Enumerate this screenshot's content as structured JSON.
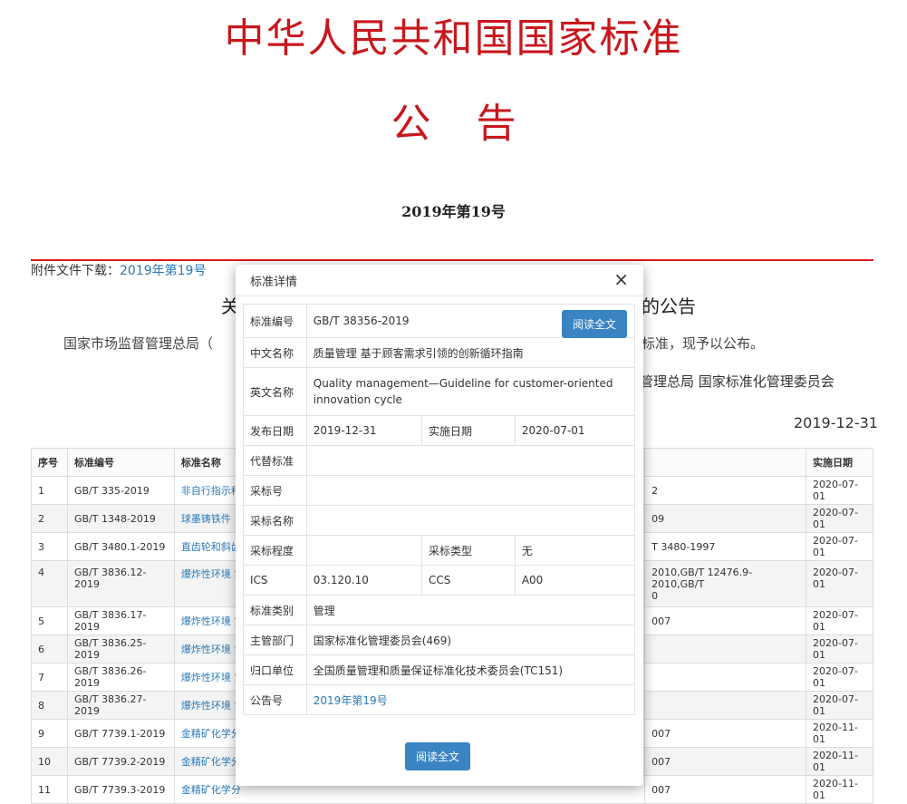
{
  "header": {
    "title": "中华人民共和国国家标准",
    "subtitle": "公告",
    "issue": "2019年第19号"
  },
  "attachment": {
    "label": "附件文件下载：",
    "link": "2019年第19号"
  },
  "background": {
    "heading_left": "关",
    "heading_right": "的公告",
    "para_left": "国家市场监督管理总局（",
    "para_right": "标准，现予以公布。",
    "signer": "管理总局 国家标准化管理委员会",
    "date": "2019-12-31"
  },
  "table": {
    "headers": [
      "序号",
      "标准编号",
      "标准名称",
      "实施日期"
    ],
    "rows": [
      {
        "no": "1",
        "code": "GB/T 335-2019",
        "name": "非自行指示秤",
        "replace": "2",
        "date": "2020-07-01"
      },
      {
        "no": "2",
        "code": "GB/T 1348-2019",
        "name": "球墨铸铁件",
        "replace": "09",
        "date": "2020-07-01"
      },
      {
        "no": "3",
        "code": "GB/T 3480.1-2019",
        "name": "直齿轮和斜齿",
        "replace": "T 3480-1997",
        "date": "2020-07-01"
      },
      {
        "no": "4",
        "code": "GB/T 3836.12-2019",
        "name": "爆炸性环境 第",
        "replace": "2010,GB/T 12476.9-2010,GB/T",
        "replace2": "0",
        "date": "2020-07-01"
      },
      {
        "no": "5",
        "code": "GB/T 3836.17-2019",
        "name": "爆炸性环境 第",
        "replace": "007",
        "date": "2020-07-01"
      },
      {
        "no": "6",
        "code": "GB/T 3836.25-2019",
        "name": "爆炸性环境 第",
        "replace": "",
        "date": "2020-07-01"
      },
      {
        "no": "7",
        "code": "GB/T 3836.26-2019",
        "name": "爆炸性环境 第",
        "replace": "",
        "date": "2020-07-01"
      },
      {
        "no": "8",
        "code": "GB/T 3836.27-2019",
        "name": "爆炸性环境 第",
        "replace": "",
        "date": "2020-07-01"
      },
      {
        "no": "9",
        "code": "GB/T 7739.1-2019",
        "name": "金精矿化学分",
        "replace": "007",
        "date": "2020-11-01"
      },
      {
        "no": "10",
        "code": "GB/T 7739.2-2019",
        "name": "金精矿化学分",
        "replace": "007",
        "date": "2020-11-01"
      },
      {
        "no": "11",
        "code": "GB/T 7739.3-2019",
        "name": "金精矿化学分",
        "replace": "007",
        "date": "2020-11-01"
      }
    ]
  },
  "modal": {
    "title": "标准详情",
    "close": "×",
    "read_btn": "阅读全文",
    "fields": {
      "code_label": "标准编号",
      "code": "GB/T 38356-2019",
      "cn_label": "中文名称",
      "cn": "质量管理 基于顾客需求引领的创新循环指南",
      "en_label": "英文名称",
      "en": "Quality management—Guideline for customer-oriented innovation cycle",
      "pub_label": "发布日期",
      "pub": "2019-12-31",
      "impl_label": "实施日期",
      "impl": "2020-07-01",
      "replace_label": "代替标准",
      "replace": "",
      "adopt_no_label": "采标号",
      "adopt_no": "",
      "adopt_name_label": "采标名称",
      "adopt_name": "",
      "adopt_degree_label": "采标程度",
      "adopt_degree": "",
      "adopt_type_label": "采标类型",
      "adopt_type": "无",
      "ics_label": "ICS",
      "ics": "03.120.10",
      "ccs_label": "CCS",
      "ccs": "A00",
      "category_label": "标准类别",
      "category": "管理",
      "dept_label": "主管部门",
      "dept": "国家标准化管理委员会(469)",
      "owner_label": "归口单位",
      "owner": "全国质量管理和质量保证标准化技术委员会(TC151)",
      "notice_label": "公告号",
      "notice": "2019年第19号"
    }
  }
}
